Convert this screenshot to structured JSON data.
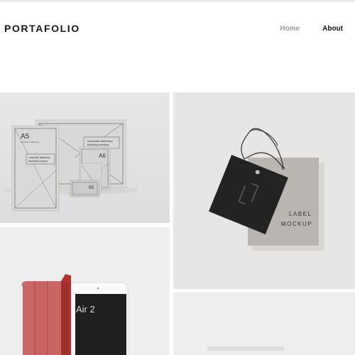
{
  "site": {
    "logo": "PORTAFOLIO"
  },
  "nav": {
    "items": [
      {
        "label": "Home"
      },
      {
        "label": "About"
      }
    ]
  },
  "grid": {
    "tiles": [
      {
        "texts": {
          "a5": "A5",
          "a5_caption": "corporate stationery",
          "banner_line1": "corporate stationery",
          "banner_line2": "branding mockup",
          "card_line1": "corporate stationery",
          "card_line2": "branding mockup",
          "a6": "A6",
          "b5": "B5"
        }
      },
      {
        "texts": {
          "line1": "LABEL",
          "line2": "MOCKUP"
        }
      },
      {
        "texts": {
          "ipad_model": "Air 2"
        }
      },
      {
        "texts": {}
      }
    ]
  },
  "colors": {
    "tile_bg_1": "#e3e4e5",
    "tile_bg_2": "#e7e6e4",
    "tile_bg_3": "#eeeeee",
    "tile_bg_4": "#eeeeef",
    "cover_red": "#c96562"
  }
}
